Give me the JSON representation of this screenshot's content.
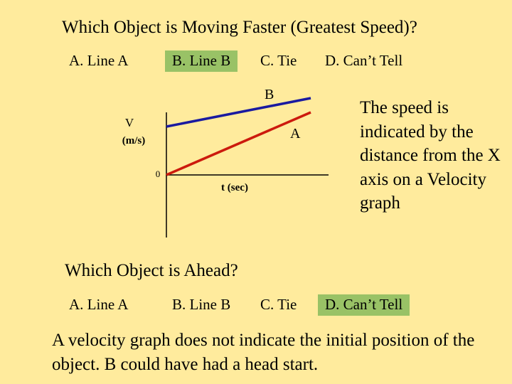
{
  "question1": {
    "title": "Which Object is Moving Faster (Greatest Speed)?",
    "options": [
      "A.  Line A",
      "B. Line B",
      "C. Tie",
      "D. Can’t Tell"
    ],
    "highlighted_index": 1
  },
  "graph": {
    "y_label_line1": "V",
    "y_label_line2": "(m/s)",
    "x_label": "t (sec)",
    "origin_label": "0",
    "line_b_label": "B",
    "line_a_label": "A",
    "line_b_color": "#1A1AA0",
    "line_a_color": "#CC1A0D"
  },
  "side_note": "The speed is indicated by the distance from the X axis on a Velocity graph",
  "question2": {
    "title": "Which Object is Ahead?",
    "options": [
      "A.  Line A",
      "B. Line B",
      "C. Tie",
      "D. Can’t Tell"
    ],
    "highlighted_index": 3
  },
  "explanation": "A velocity graph does not indicate the initial position of the object. B could have had a head start.",
  "highlight_color": "#99C266"
}
